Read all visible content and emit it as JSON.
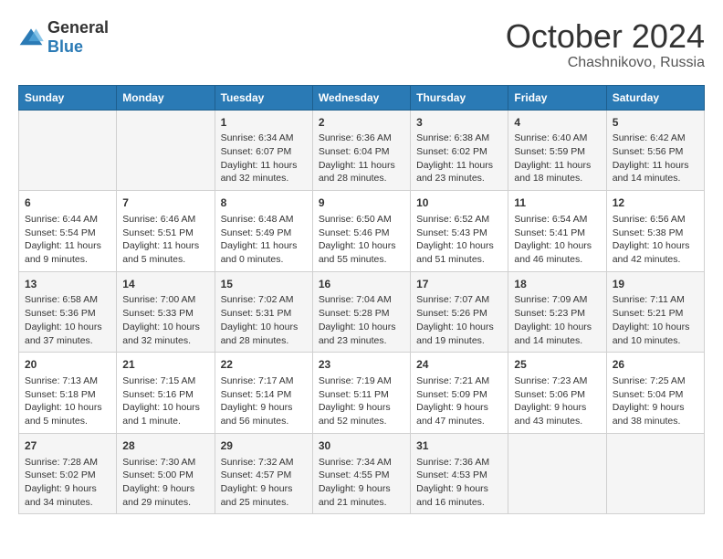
{
  "logo": {
    "general": "General",
    "blue": "Blue"
  },
  "title": {
    "month": "October 2024",
    "location": "Chashnikovo, Russia"
  },
  "weekdays": [
    "Sunday",
    "Monday",
    "Tuesday",
    "Wednesday",
    "Thursday",
    "Friday",
    "Saturday"
  ],
  "weeks": [
    [
      {
        "day": "",
        "content": ""
      },
      {
        "day": "",
        "content": ""
      },
      {
        "day": "1",
        "content": "Sunrise: 6:34 AM\nSunset: 6:07 PM\nDaylight: 11 hours and 32 minutes."
      },
      {
        "day": "2",
        "content": "Sunrise: 6:36 AM\nSunset: 6:04 PM\nDaylight: 11 hours and 28 minutes."
      },
      {
        "day": "3",
        "content": "Sunrise: 6:38 AM\nSunset: 6:02 PM\nDaylight: 11 hours and 23 minutes."
      },
      {
        "day": "4",
        "content": "Sunrise: 6:40 AM\nSunset: 5:59 PM\nDaylight: 11 hours and 18 minutes."
      },
      {
        "day": "5",
        "content": "Sunrise: 6:42 AM\nSunset: 5:56 PM\nDaylight: 11 hours and 14 minutes."
      }
    ],
    [
      {
        "day": "6",
        "content": "Sunrise: 6:44 AM\nSunset: 5:54 PM\nDaylight: 11 hours and 9 minutes."
      },
      {
        "day": "7",
        "content": "Sunrise: 6:46 AM\nSunset: 5:51 PM\nDaylight: 11 hours and 5 minutes."
      },
      {
        "day": "8",
        "content": "Sunrise: 6:48 AM\nSunset: 5:49 PM\nDaylight: 11 hours and 0 minutes."
      },
      {
        "day": "9",
        "content": "Sunrise: 6:50 AM\nSunset: 5:46 PM\nDaylight: 10 hours and 55 minutes."
      },
      {
        "day": "10",
        "content": "Sunrise: 6:52 AM\nSunset: 5:43 PM\nDaylight: 10 hours and 51 minutes."
      },
      {
        "day": "11",
        "content": "Sunrise: 6:54 AM\nSunset: 5:41 PM\nDaylight: 10 hours and 46 minutes."
      },
      {
        "day": "12",
        "content": "Sunrise: 6:56 AM\nSunset: 5:38 PM\nDaylight: 10 hours and 42 minutes."
      }
    ],
    [
      {
        "day": "13",
        "content": "Sunrise: 6:58 AM\nSunset: 5:36 PM\nDaylight: 10 hours and 37 minutes."
      },
      {
        "day": "14",
        "content": "Sunrise: 7:00 AM\nSunset: 5:33 PM\nDaylight: 10 hours and 32 minutes."
      },
      {
        "day": "15",
        "content": "Sunrise: 7:02 AM\nSunset: 5:31 PM\nDaylight: 10 hours and 28 minutes."
      },
      {
        "day": "16",
        "content": "Sunrise: 7:04 AM\nSunset: 5:28 PM\nDaylight: 10 hours and 23 minutes."
      },
      {
        "day": "17",
        "content": "Sunrise: 7:07 AM\nSunset: 5:26 PM\nDaylight: 10 hours and 19 minutes."
      },
      {
        "day": "18",
        "content": "Sunrise: 7:09 AM\nSunset: 5:23 PM\nDaylight: 10 hours and 14 minutes."
      },
      {
        "day": "19",
        "content": "Sunrise: 7:11 AM\nSunset: 5:21 PM\nDaylight: 10 hours and 10 minutes."
      }
    ],
    [
      {
        "day": "20",
        "content": "Sunrise: 7:13 AM\nSunset: 5:18 PM\nDaylight: 10 hours and 5 minutes."
      },
      {
        "day": "21",
        "content": "Sunrise: 7:15 AM\nSunset: 5:16 PM\nDaylight: 10 hours and 1 minute."
      },
      {
        "day": "22",
        "content": "Sunrise: 7:17 AM\nSunset: 5:14 PM\nDaylight: 9 hours and 56 minutes."
      },
      {
        "day": "23",
        "content": "Sunrise: 7:19 AM\nSunset: 5:11 PM\nDaylight: 9 hours and 52 minutes."
      },
      {
        "day": "24",
        "content": "Sunrise: 7:21 AM\nSunset: 5:09 PM\nDaylight: 9 hours and 47 minutes."
      },
      {
        "day": "25",
        "content": "Sunrise: 7:23 AM\nSunset: 5:06 PM\nDaylight: 9 hours and 43 minutes."
      },
      {
        "day": "26",
        "content": "Sunrise: 7:25 AM\nSunset: 5:04 PM\nDaylight: 9 hours and 38 minutes."
      }
    ],
    [
      {
        "day": "27",
        "content": "Sunrise: 7:28 AM\nSunset: 5:02 PM\nDaylight: 9 hours and 34 minutes."
      },
      {
        "day": "28",
        "content": "Sunrise: 7:30 AM\nSunset: 5:00 PM\nDaylight: 9 hours and 29 minutes."
      },
      {
        "day": "29",
        "content": "Sunrise: 7:32 AM\nSunset: 4:57 PM\nDaylight: 9 hours and 25 minutes."
      },
      {
        "day": "30",
        "content": "Sunrise: 7:34 AM\nSunset: 4:55 PM\nDaylight: 9 hours and 21 minutes."
      },
      {
        "day": "31",
        "content": "Sunrise: 7:36 AM\nSunset: 4:53 PM\nDaylight: 9 hours and 16 minutes."
      },
      {
        "day": "",
        "content": ""
      },
      {
        "day": "",
        "content": ""
      }
    ]
  ]
}
